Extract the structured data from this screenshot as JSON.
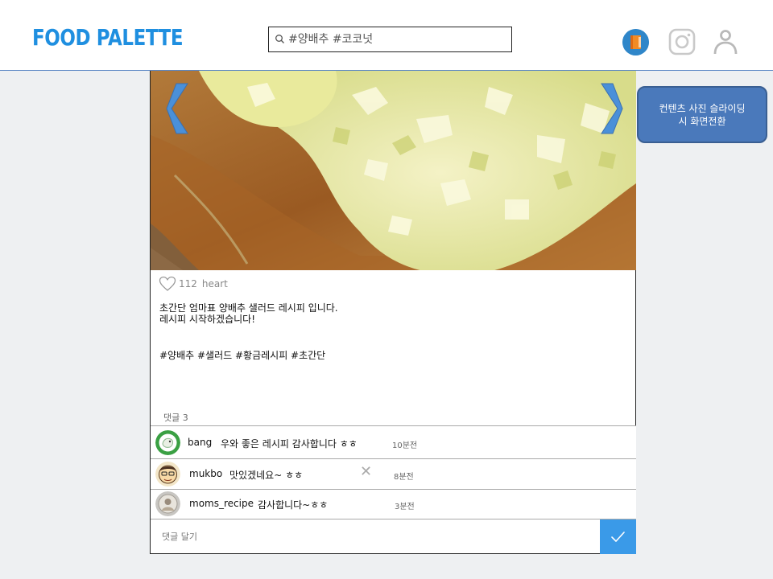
{
  "header": {
    "logo": "FOOD PALETTE",
    "search_placeholder": "#양배추 #코코넛"
  },
  "post": {
    "likes_count": "112",
    "likes_label": "heart",
    "caption_line1": "초간단 엄마표 양배추 샐러드 레시피 입니다.",
    "caption_line2": "레시피 시작하겠습니다!",
    "hashtags": "#양배추 #샐러드 #황금레시피 #초간단",
    "comment_count": "댓글 3",
    "comments": [
      {
        "user": "bang",
        "text": "우와 좋은 레시피 감사합니다 ㅎㅎ",
        "time": "10분전"
      },
      {
        "user": "mukbo",
        "text": "맛있겠네요~ ㅎㅎ",
        "time": "8분전"
      },
      {
        "user": "moms_recipe",
        "text": "감사합니다~ㅎㅎ",
        "time": "3분전"
      }
    ],
    "comment_placeholder": "댓글 달기"
  },
  "note": {
    "line1": "컨텐츠 사진 슬라이딩",
    "line2": "시 화면전환"
  },
  "icons": [
    "search-icon",
    "book-icon",
    "instagram-icon",
    "user-icon",
    "heart-icon",
    "chevron-left-icon",
    "chevron-right-icon",
    "close-icon",
    "check-icon"
  ],
  "colors": {
    "accent": "#1f8fe0",
    "submit": "#3a9ae8",
    "note_bg": "#4a79bb",
    "arrow": "#4a90d9"
  }
}
